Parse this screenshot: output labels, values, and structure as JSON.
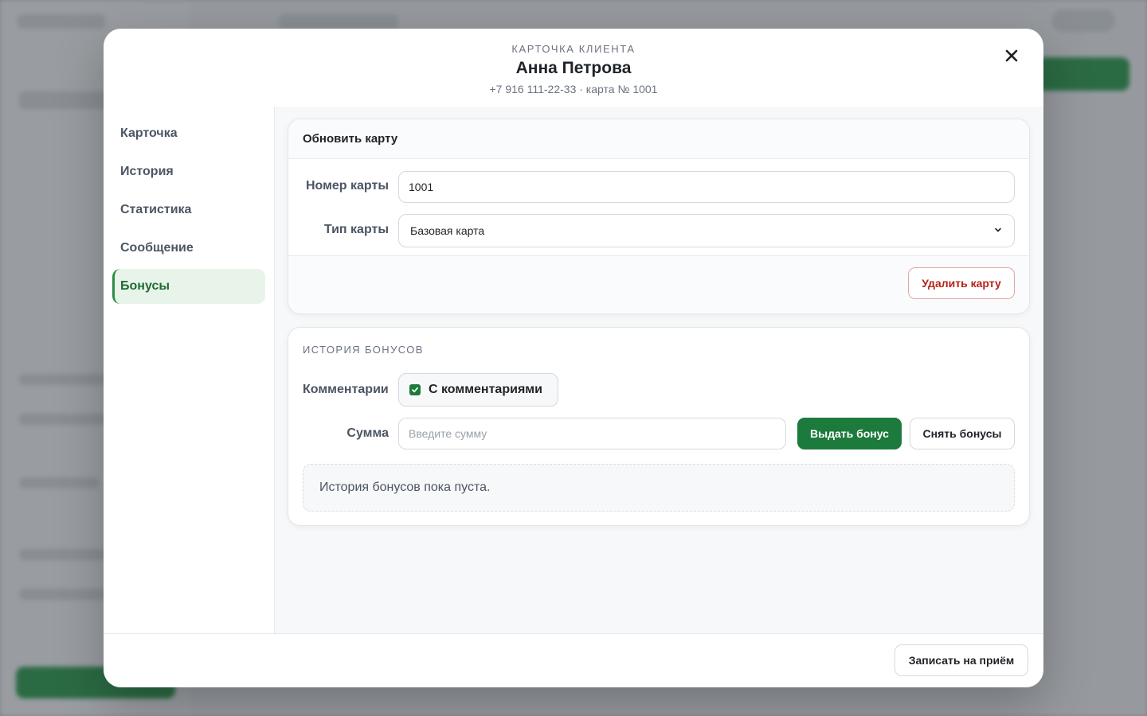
{
  "modal": {
    "eyebrow": "КАРТОЧКА КЛИЕНТА",
    "client_name": "Анна Петрова",
    "client_sub": "+7 916 111-22-33 · карта № 1001",
    "close_icon": "close-icon"
  },
  "nav": {
    "items": [
      {
        "label": "Карточка"
      },
      {
        "label": "История"
      },
      {
        "label": "Статистика"
      },
      {
        "label": "Сообщение"
      },
      {
        "label": "Бонусы"
      }
    ],
    "active": "Бонусы"
  },
  "update_card": {
    "title": "Обновить карту",
    "card_number_label": "Номер карты",
    "card_number_value": "1001",
    "card_type_label": "Тип карты",
    "card_type_value": "Базовая карта",
    "delete_label": "Удалить карту"
  },
  "bonus_history": {
    "title": "ИСТОРИЯ БОНУСОВ",
    "comments_label": "Комментарии",
    "comments_checkbox_label": "С комментариями",
    "comments_checked": true,
    "amount_label": "Сумма",
    "amount_placeholder": "Введите сумму",
    "give_label": "Выдать бонус",
    "take_label": "Снять бонусы",
    "empty_text": "История бонусов пока пуста."
  },
  "footer": {
    "book_label": "Записать на приём"
  },
  "colors": {
    "accent": "#1c7a3c",
    "danger": "#b42318",
    "active_nav_bg": "#e8f4ea"
  }
}
